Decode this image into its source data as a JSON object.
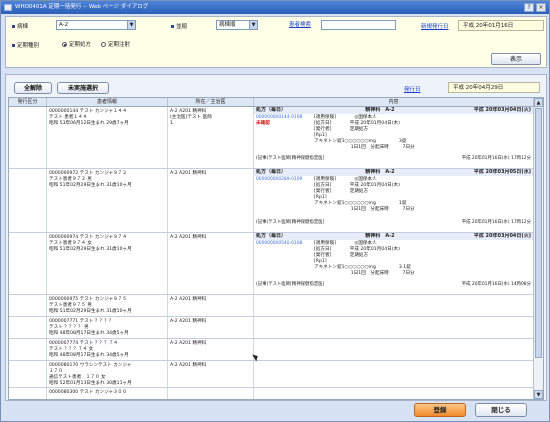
{
  "window": {
    "title": "WHO0401A 定期一括発行 -- Web ページ ダイアログ"
  },
  "filter": {
    "ward_label": "病棟",
    "ward_value": "A-2",
    "sort_label": "並順",
    "sort_value": "病棟順",
    "search_link": "患者検索",
    "search_value": "",
    "new_date_link": "新規発行日",
    "new_date_value": "平成 20年01月16日",
    "type_label": "定期種別",
    "radio_regular": "定期処方",
    "radio_injection": "定期注射",
    "display_button": "表示"
  },
  "panel": {
    "clear_all_button": "全解除",
    "unexecuted_button": "未実施選択",
    "issue_date_link": "発行日",
    "issue_date_value": "平成 20年04月29日"
  },
  "table": {
    "headers": [
      "発行区分",
      "患者情報",
      "所在／主治医",
      "内容"
    ],
    "rows": [
      {
        "patient": [
          "0000000144 テスト カンジャ１４４",
          "テスト 患者１４４",
          "昭和 53年06月12日生まれ 29歳7ヶ月"
        ],
        "location": [
          "A-2 A201 精神科",
          "(主治医)テスト 医師",
          "1"
        ],
        "rx": {
          "head_left": "処方（毎日）",
          "head_mid": "精神科　A-2",
          "head_right": "平成 20年03月04日(火)",
          "id": "000000000144-0108",
          "status": "未確認",
          "lines": [
            "[適用保険]　　　　◎国保本人",
            "[処方日]　　　　平成 20年01月04日(木)",
            "[発行者]　　　　定期処方",
            "[Rp1]",
            "アキネトン錠1○○○○○○mg　　　　　3錠",
            "　　　　　　　　1日1回　分起床時　　　7日分"
          ],
          "foot_left": "(記事)テスト医師[精神保健指定医]",
          "foot_right": "平成 20年01月16日(水) 17時12分"
        }
      },
      {
        "patient": [
          "0000000972 テスト カンジャ９７２",
          "テスト患者９７２ 男",
          "昭和 51年02月29日生まれ 31歳10ヶ月"
        ],
        "location": [
          "A-2 A201 精神科"
        ],
        "rx": {
          "head_left": "処方（毎日）",
          "head_mid": "精神科　A-2",
          "head_right": "平成 20年03月05日(水)",
          "id": "000000000289-0109",
          "status": "",
          "lines": [
            "[適用保険]　　　　◎国保本人",
            "[処方日]　　　　平成 20年01月04日(木)",
            "[発行者]　　　　定期処方",
            "[Rp1]",
            "アキネトン錠1○○○○○○mg　　　　　1錠",
            "　　　　　　　　1日1回　分起床時　　　7日分"
          ],
          "foot_left": "(記事)テスト医師[精神保健指定医]",
          "foot_right": "平成 20年01月16日(水) 17時12分"
        }
      },
      {
        "patient": [
          "0000000974 テスト カンジャ９７４",
          "テスト患者９７４ 女",
          "昭和 51年02月29日生まれ 31歳10ヶ月"
        ],
        "location": [
          "A-2 A201 精神科"
        ],
        "rx": {
          "head_left": "処方（毎日）",
          "head_mid": "精神科　A-2",
          "head_right": "平成 20年03月04日(火)",
          "id": "000000000540-0108",
          "status": "",
          "lines": [
            "[適用保険]　　　　◎国保本人",
            "[処方日]　　　　平成 20年01月04日(木)",
            "[発行者]　　　　定期処方",
            "[Rp1]",
            "アキネトン錠1○○○○○○mg　　　　　3.1錠",
            "　　　　　　　　1日1回　分起床時　　　7日分"
          ],
          "foot_left": "(記事)テスト医師[精神保健指定医]",
          "foot_right": "平成 20年01月16日(水) 14時08分"
        }
      },
      {
        "patient": [
          "0000000975 テスト カンジャ９７５",
          "テスト患者９７５ 男",
          "昭和 51年02月29日生まれ 31歳10ヶ月"
        ],
        "location": [
          "A-2 A201 精神科"
        ]
      },
      {
        "patient": [
          "0000007771 テスト ？？？？",
          "テスト ？？？？ 男",
          "昭和 48年08月17日生まれ 34歳5ヶ月"
        ],
        "location": [
          "A-2 A201 精神科"
        ]
      },
      {
        "patient": [
          "0000007774 テスト ？？？７４",
          "テスト ？？？７４ 女",
          "昭和 48年08月17日生まれ 34歳5ヶ月"
        ],
        "location": [
          "A-2 A201 精神科"
        ]
      },
      {
        "patient": [
          "0000080170 ウラシンテスト カンジャ",
          "１７０",
          "通信テスト患者　１７０ 女",
          "昭和 52年01月13日生まれ 30歳11ヶ月"
        ],
        "location": [
          "A-2 A201 精神科"
        ]
      },
      {
        "patient": [
          "0000080300 テスト カンジャ３００"
        ],
        "location": [
          ""
        ]
      }
    ]
  },
  "footer": {
    "register_button": "登録",
    "close_button": "閉じる"
  },
  "colors": {
    "title_bar": "#2b5fb8",
    "filter_bg": "#ffffe8",
    "primary_button": "#f08a2a",
    "warning_text": "#d81818"
  }
}
